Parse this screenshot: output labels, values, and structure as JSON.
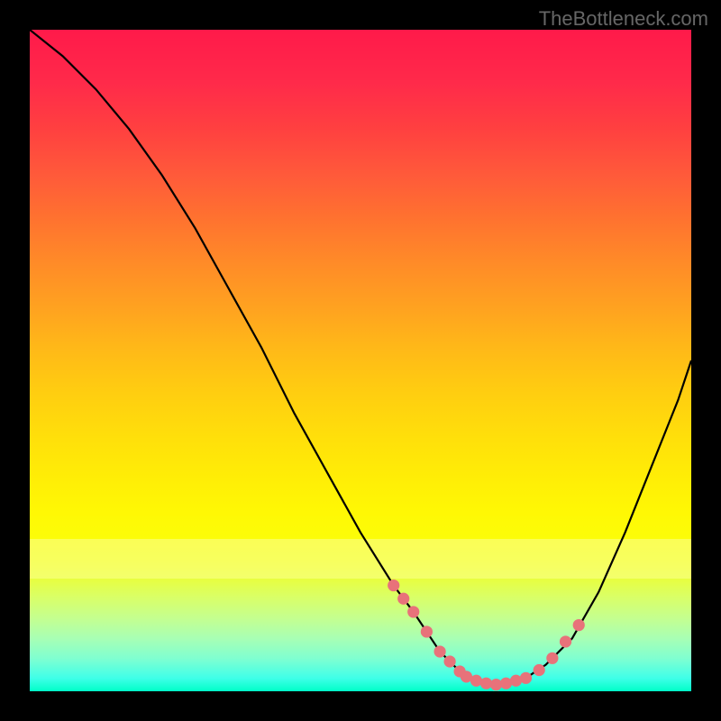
{
  "watermark": "TheBottleneck.com",
  "chart_data": {
    "type": "line",
    "title": "",
    "xlabel": "",
    "ylabel": "",
    "xlim": [
      0,
      100
    ],
    "ylim": [
      0,
      100
    ],
    "series": [
      {
        "name": "bottleneck-curve",
        "x": [
          0,
          5,
          10,
          15,
          20,
          25,
          30,
          35,
          40,
          45,
          50,
          55,
          58,
          60,
          62,
          65,
          68,
          70,
          72,
          75,
          78,
          82,
          86,
          90,
          94,
          98,
          100
        ],
        "values": [
          100,
          96,
          91,
          85,
          78,
          70,
          61,
          52,
          42,
          33,
          24,
          16,
          12,
          9,
          6,
          3,
          1.5,
          1,
          1.2,
          2,
          4,
          8,
          15,
          24,
          34,
          44,
          50
        ]
      },
      {
        "name": "highlight-dots",
        "x": [
          55,
          56.5,
          58,
          60,
          62,
          63.5,
          65,
          66,
          67.5,
          69,
          70.5,
          72,
          73.5,
          75,
          77,
          79,
          81,
          83
        ],
        "values": [
          16,
          14,
          12,
          9,
          6,
          4.5,
          3,
          2.2,
          1.6,
          1.2,
          1,
          1.2,
          1.6,
          2,
          3.2,
          5,
          7.5,
          10
        ]
      }
    ],
    "gradient_stops": [
      {
        "pct": 0,
        "color": "#ff1a4a"
      },
      {
        "pct": 50,
        "color": "#ffce10"
      },
      {
        "pct": 80,
        "color": "#f4fe1a"
      },
      {
        "pct": 100,
        "color": "#00ffc8"
      }
    ],
    "dot_color": "#e8727a",
    "curve_color": "#000000"
  }
}
